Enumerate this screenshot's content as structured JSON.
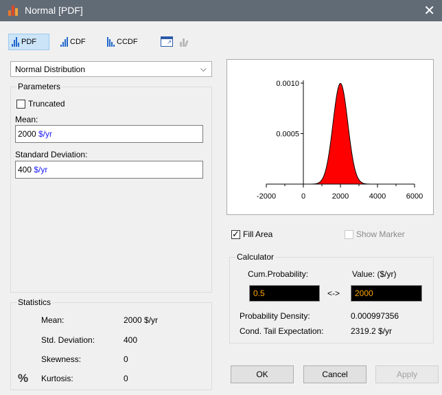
{
  "window": {
    "title": "Normal [PDF]",
    "close_glyph": "✕",
    "icon": "bar-chart-icon"
  },
  "toolbar": {
    "pdf_label": "PDF",
    "cdf_label": "CDF",
    "ccdf_label": "CCDF",
    "active_tab": "PDF"
  },
  "distribution": {
    "selected": "Normal Distribution"
  },
  "parameters": {
    "group_label": "Parameters",
    "truncated_label": "Truncated",
    "truncated_checked": false,
    "mean_label": "Mean:",
    "mean_value": "2000",
    "mean_unit": "$/yr",
    "sd_label": "Standard Deviation:",
    "sd_value": "400",
    "sd_unit": "$/yr"
  },
  "statistics": {
    "group_label": "Statistics",
    "percent_glyph": "%",
    "rows": [
      {
        "label": "Mean:",
        "value": "2000 $/yr"
      },
      {
        "label": "Std. Deviation:",
        "value": "400"
      },
      {
        "label": "Skewness:",
        "value": "0"
      },
      {
        "label": "Kurtosis:",
        "value": "0"
      }
    ]
  },
  "chart_data": {
    "type": "area",
    "distribution": "normal",
    "mean": 2000,
    "sd": 400,
    "xlim": [
      -2000,
      6000
    ],
    "ylim": [
      0,
      0.001
    ],
    "x_ticks": [
      "-2000",
      "0",
      "2000",
      "4000",
      "6000"
    ],
    "y_ticks": [
      "0.0005",
      "0.0010"
    ],
    "y_tick_values": [
      0.0005,
      0.001
    ],
    "x_tick_values": [
      -2000,
      0,
      2000,
      4000,
      6000
    ],
    "fill_color": "#ff0000",
    "title": "",
    "xlabel": "",
    "ylabel": ""
  },
  "options": {
    "fill_area_label": "Fill Area",
    "fill_area_checked": true,
    "show_marker_label": "Show Marker",
    "show_marker_checked": false
  },
  "calculator": {
    "group_label": "Calculator",
    "cum_prob_label": "Cum.Probability:",
    "value_label": "Value: ($/yr)",
    "cum_prob_value": "0.5",
    "arrow_glyph": "<->",
    "value_value": "2000",
    "density_label": "Probability Density:",
    "density_value": "0.000997356",
    "cte_label": "Cond. Tail Expectation:",
    "cte_value": "2319.2 $/yr"
  },
  "buttons": {
    "ok": "OK",
    "cancel": "Cancel",
    "apply": "Apply"
  }
}
